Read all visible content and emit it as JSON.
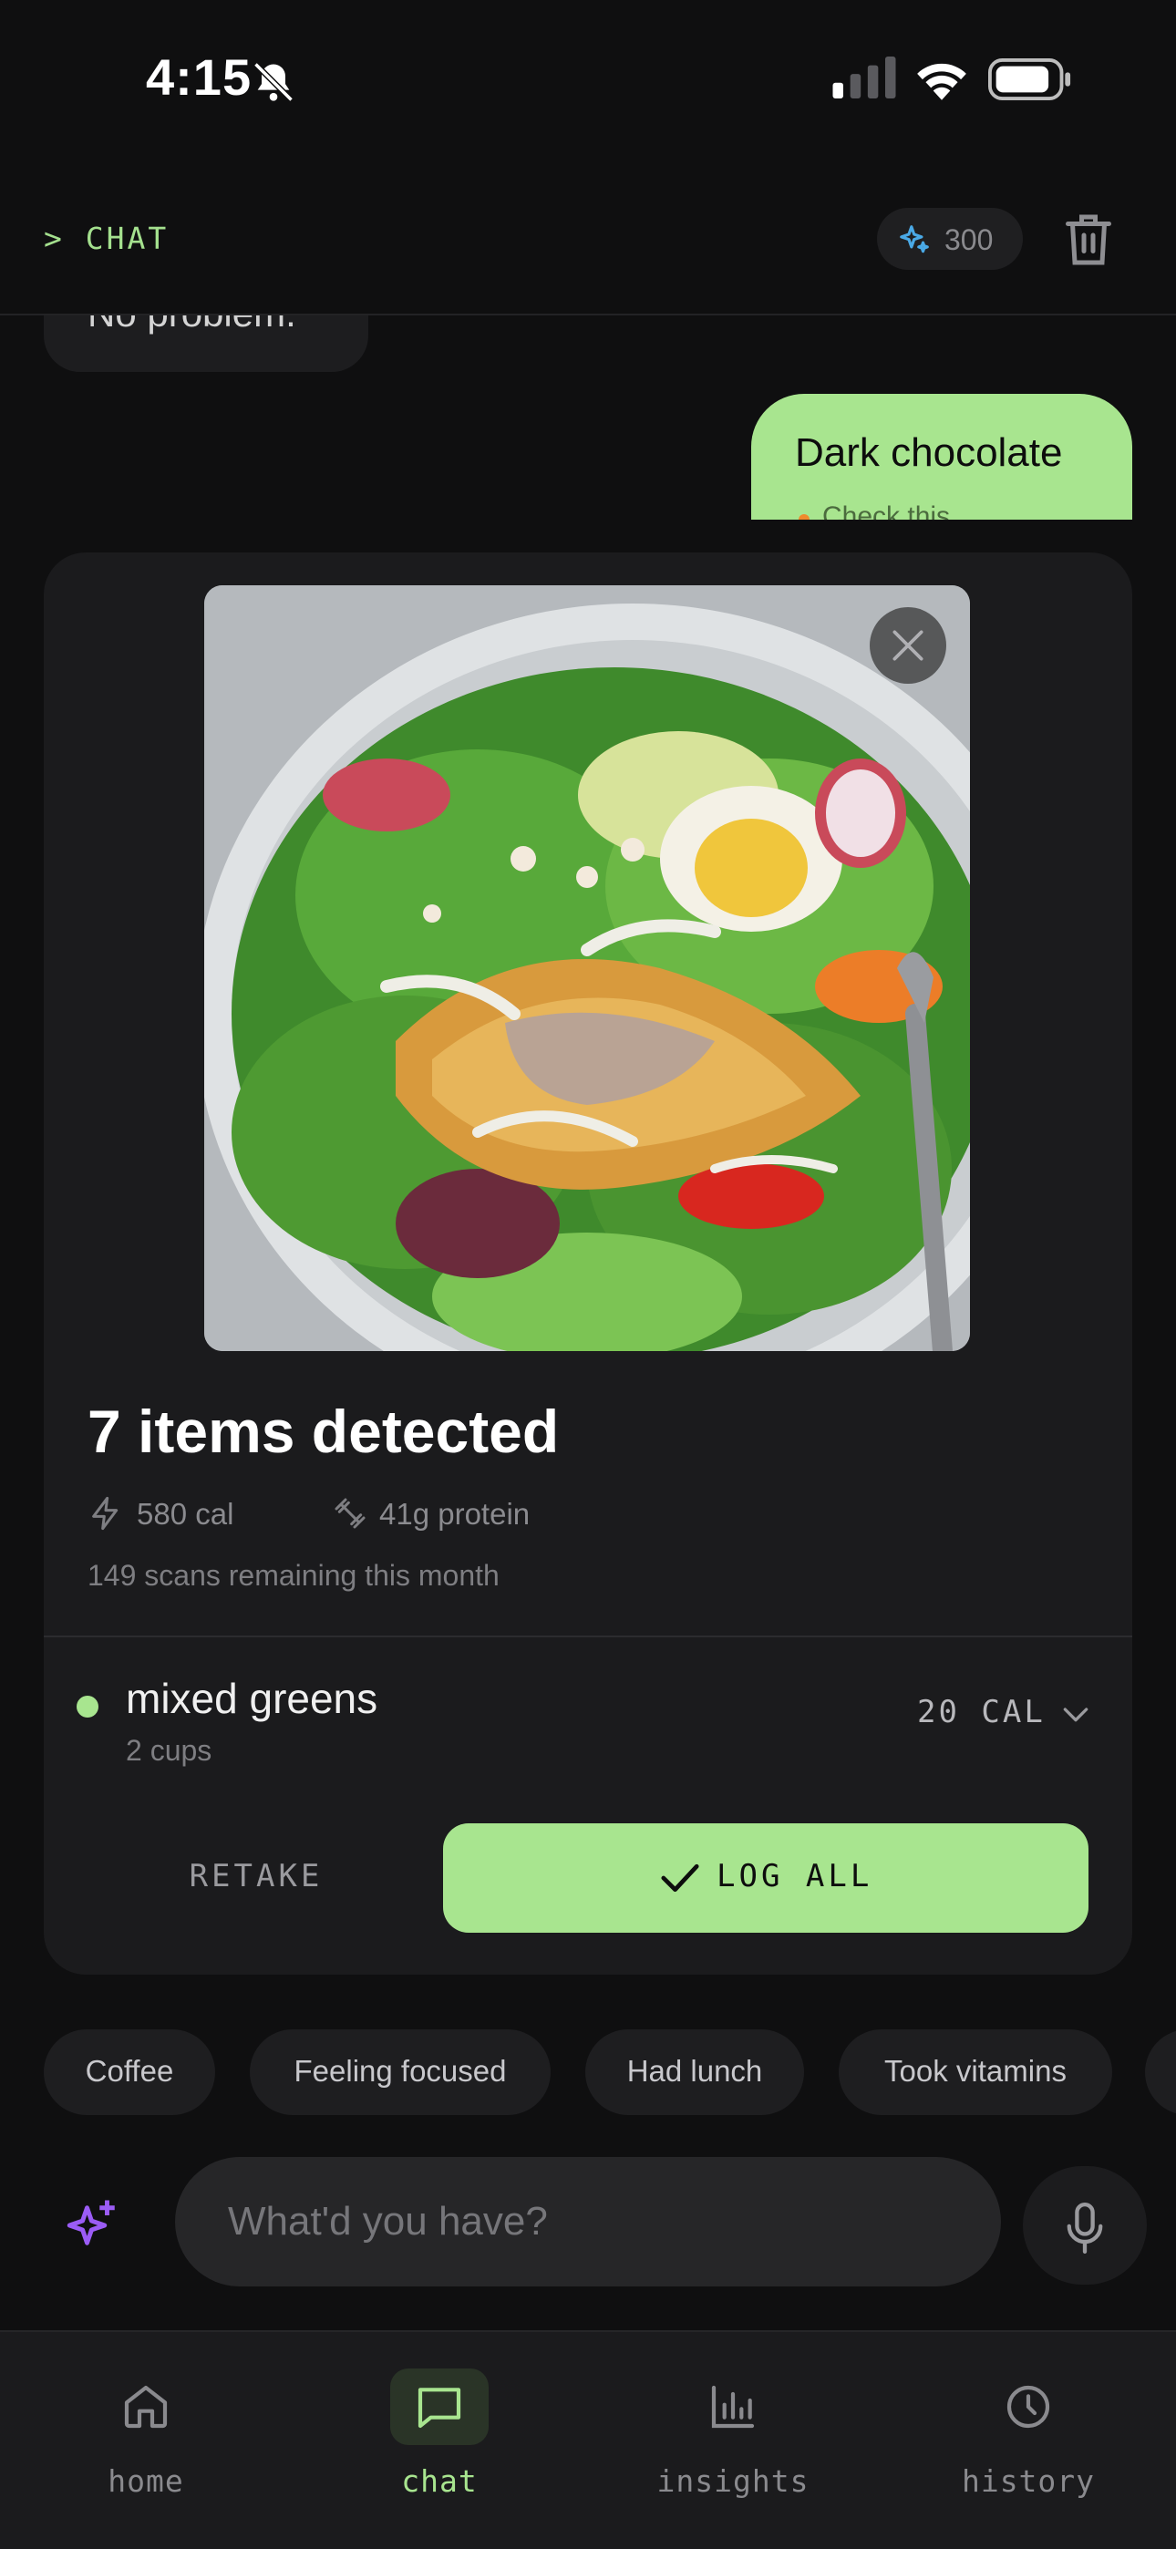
{
  "status_bar": {
    "time": "4:15"
  },
  "header": {
    "title": "> CHAT",
    "credits": "300"
  },
  "chat": {
    "assistant_message": "No problem.",
    "user_message": "Dark chocolate",
    "user_message_sub": "Check this"
  },
  "scan": {
    "title": "7 items detected",
    "calories": "580 cal",
    "protein": "41g protein",
    "scans_remaining": "149 scans remaining this month",
    "item": {
      "name": "mixed greens",
      "quantity": "2 cups",
      "calories": "20 CAL"
    },
    "retake_label": "RETAKE",
    "log_all_label": "LOG ALL"
  },
  "chips": [
    "Coffee",
    "Feeling focused",
    "Had lunch",
    "Took vitamins"
  ],
  "composer": {
    "placeholder": "What'd you have?"
  },
  "nav": {
    "home": "home",
    "chat": "chat",
    "insights": "insights",
    "history": "history"
  },
  "colors": {
    "accent": "#a8e58f",
    "background": "#0f0f10",
    "card": "#1b1b1d",
    "ai_purple": "#9b5cf5"
  }
}
